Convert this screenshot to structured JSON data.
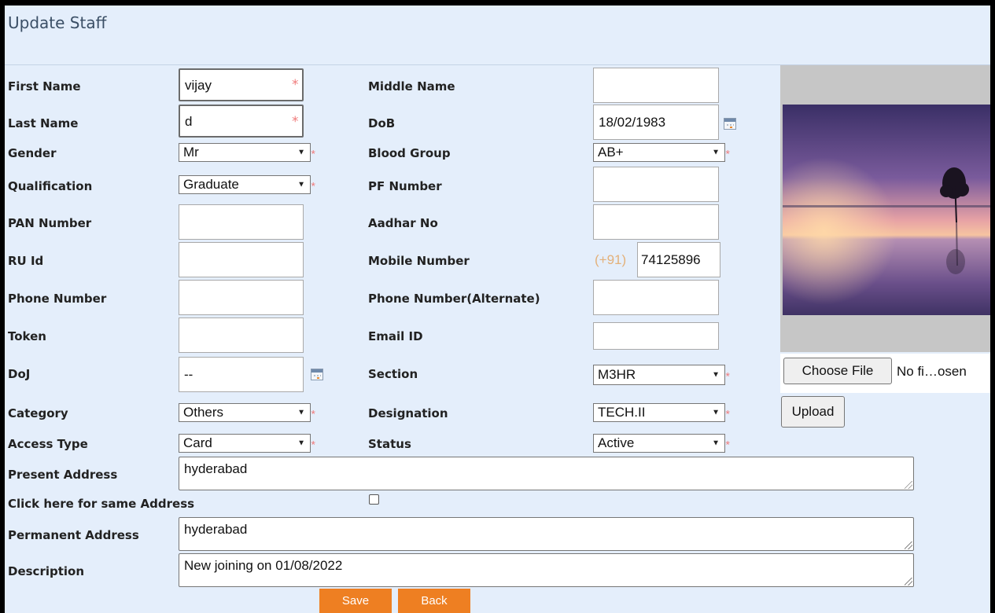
{
  "title": "Update Staff",
  "fields": {
    "first_name": {
      "label": "First Name",
      "value": "vijay"
    },
    "middle_name": {
      "label": "Middle Name",
      "value": ""
    },
    "last_name": {
      "label": "Last Name",
      "value": "d"
    },
    "dob": {
      "label": "DoB",
      "value": "18/02/1983"
    },
    "gender": {
      "label": "Gender",
      "value": "Mr"
    },
    "blood_group": {
      "label": "Blood Group",
      "value": "AB+"
    },
    "qualification": {
      "label": "Qualification",
      "value": "Graduate"
    },
    "pf_number": {
      "label": "PF Number",
      "value": ""
    },
    "pan_number": {
      "label": "PAN Number",
      "value": ""
    },
    "aadhar_no": {
      "label": "Aadhar No",
      "value": ""
    },
    "ru_id": {
      "label": "RU Id",
      "value": ""
    },
    "mobile_number": {
      "label": "Mobile Number",
      "prefix": "(+91)",
      "value": "74125896"
    },
    "phone_number": {
      "label": "Phone Number",
      "value": ""
    },
    "phone_alternate": {
      "label": "Phone Number(Alternate)",
      "value": ""
    },
    "token": {
      "label": "Token",
      "value": ""
    },
    "email_id": {
      "label": "Email ID",
      "value": ""
    },
    "doj": {
      "label": "DoJ",
      "value": "--"
    },
    "section": {
      "label": "Section",
      "value": "M3HR"
    },
    "category": {
      "label": "Category",
      "value": "Others"
    },
    "designation": {
      "label": "Designation",
      "value": "TECH.II"
    },
    "access_type": {
      "label": "Access Type",
      "value": "Card"
    },
    "status": {
      "label": "Status",
      "value": "Active"
    },
    "present_address": {
      "label": "Present Address",
      "value": "hyderabad"
    },
    "same_address": {
      "label": "Click here for same Address"
    },
    "permanent_address": {
      "label": "Permanent Address",
      "value": "hyderabad"
    },
    "description": {
      "label": "Description",
      "value": "New joining on 01/08/2022"
    }
  },
  "required_marker": "*",
  "photo": {
    "choose_file_label": "Choose File",
    "file_status": "No fi…osen",
    "upload_label": "Upload"
  },
  "actions": {
    "save_label": "Save",
    "back_label": "Back"
  },
  "colors": {
    "background": "#e4eefb",
    "button_orange": "#ee7f22",
    "required_star": "#f07a7a"
  }
}
